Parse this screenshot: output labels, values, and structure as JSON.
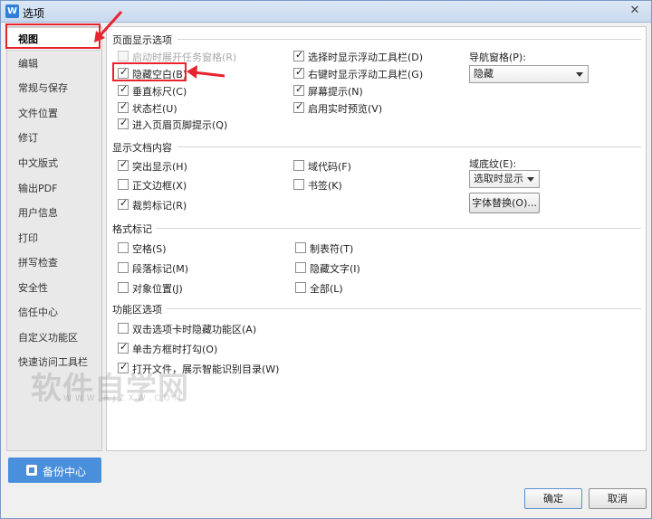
{
  "window": {
    "title": "选项",
    "app_icon": "W",
    "close_glyph": "✕"
  },
  "sidebar": {
    "items": [
      {
        "label": "视图",
        "active": true
      },
      {
        "label": "编辑"
      },
      {
        "label": "常规与保存"
      },
      {
        "label": "文件位置"
      },
      {
        "label": "修订"
      },
      {
        "label": "中文版式"
      },
      {
        "label": "输出PDF"
      },
      {
        "label": "用户信息"
      },
      {
        "label": "打印"
      },
      {
        "label": "拼写检查"
      },
      {
        "label": "安全性"
      },
      {
        "label": "信任中心"
      },
      {
        "label": "自定义功能区"
      },
      {
        "label": "快速访问工具栏"
      }
    ],
    "backup_label": "备份中心"
  },
  "sections": {
    "page_display": {
      "title": "页面显示选项",
      "options": [
        {
          "label": "启动时展开任务窗格(R)",
          "checked": false,
          "disabled": true
        },
        {
          "label": "隐藏空白(B)",
          "checked": true
        },
        {
          "label": "垂直标尺(C)",
          "checked": true
        },
        {
          "label": "状态栏(U)",
          "checked": true
        },
        {
          "label": "进入页眉页脚提示(Q)",
          "checked": true
        },
        {
          "label": "选择时显示浮动工具栏(D)",
          "checked": true
        },
        {
          "label": "右键时显示浮动工具栏(G)",
          "checked": true
        },
        {
          "label": "屏幕提示(N)",
          "checked": true
        },
        {
          "label": "启用实时预览(V)",
          "checked": true
        }
      ],
      "nav_pane_label": "导航窗格(P):",
      "nav_pane_value": "隐藏"
    },
    "doc_content": {
      "title": "显示文档内容",
      "options": [
        {
          "label": "突出显示(H)",
          "checked": true
        },
        {
          "label": "正文边框(X)",
          "checked": false
        },
        {
          "label": "裁剪标记(R)",
          "checked": true
        },
        {
          "label": "域代码(F)",
          "checked": false
        },
        {
          "label": "书签(K)",
          "checked": false
        }
      ],
      "field_shading_label": "域底纹(E):",
      "field_shading_value": "选取时显示",
      "font_replace_label": "字体替换(O)..."
    },
    "format_marks": {
      "title": "格式标记",
      "options": [
        {
          "label": "空格(S)",
          "checked": false
        },
        {
          "label": "段落标记(M)",
          "checked": false
        },
        {
          "label": "对象位置(J)",
          "checked": false
        },
        {
          "label": "制表符(T)",
          "checked": false
        },
        {
          "label": "隐藏文字(I)",
          "checked": false
        },
        {
          "label": "全部(L)",
          "checked": false
        }
      ]
    },
    "ribbon": {
      "title": "功能区选项",
      "options": [
        {
          "label": "双击选项卡时隐藏功能区(A)",
          "checked": false
        },
        {
          "label": "单击方框时打勾(O)",
          "checked": true
        },
        {
          "label": "打开文件，展示智能识别目录(W)",
          "checked": true
        }
      ]
    }
  },
  "footer": {
    "ok_label": "确定",
    "cancel_label": "取消"
  },
  "watermark": {
    "text": "软件自学网",
    "url": "WWW.RJZXW.COM"
  },
  "annotation_color": "#e8232e"
}
